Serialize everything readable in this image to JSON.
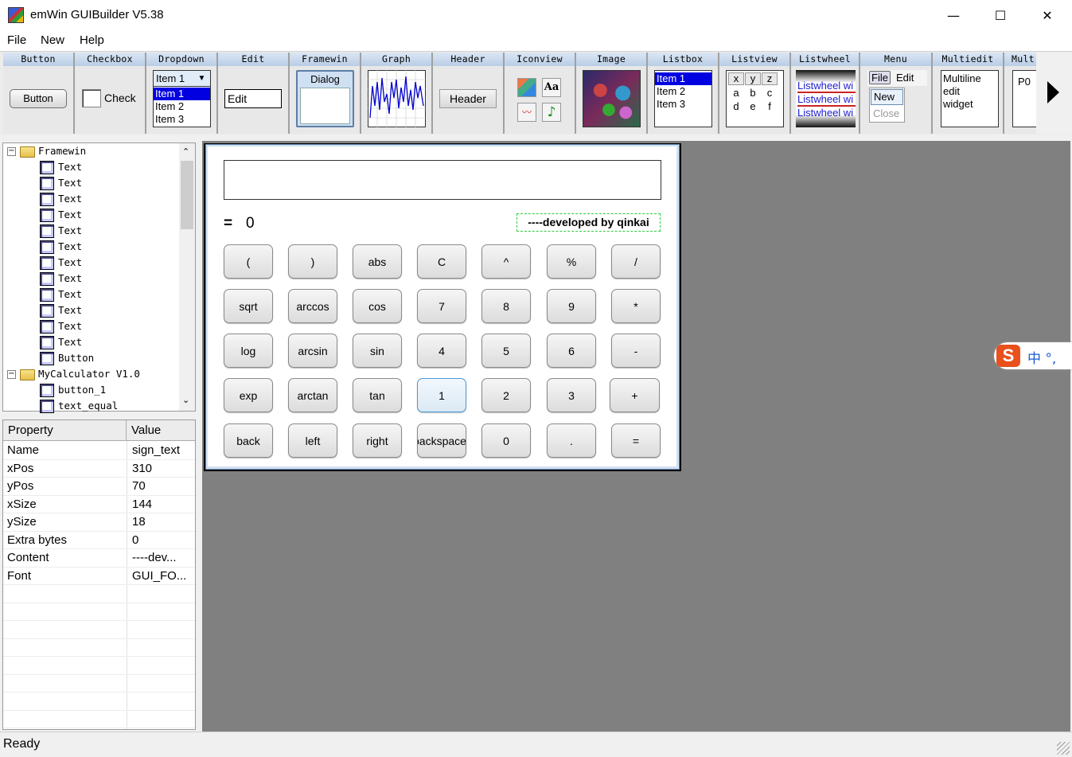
{
  "app": {
    "title": "emWin GUIBuilder V5.38",
    "min": "—",
    "max": "☐",
    "close": "✕"
  },
  "menu": [
    "File",
    "New",
    "Help"
  ],
  "palette": [
    {
      "label": "Button",
      "sample": "Button"
    },
    {
      "label": "Checkbox",
      "sample": "Check"
    },
    {
      "label": "Dropdown",
      "selected": "Item 1",
      "items": [
        "Item 1",
        "Item 2",
        "Item 3"
      ]
    },
    {
      "label": "Edit",
      "sample": "Edit"
    },
    {
      "label": "Framewin",
      "sample": "Dialog"
    },
    {
      "label": "Graph"
    },
    {
      "label": "Header",
      "sample": "Header"
    },
    {
      "label": "Iconview",
      "icons": [
        "Aa",
        "♪"
      ]
    },
    {
      "label": "Image"
    },
    {
      "label": "Listbox",
      "items": [
        "Item 1",
        "Item 2",
        "Item 3"
      ]
    },
    {
      "label": "Listview",
      "cells": [
        [
          "x",
          "y",
          "z"
        ],
        [
          "a",
          "b",
          "c"
        ],
        [
          "d",
          "e",
          "f"
        ]
      ]
    },
    {
      "label": "Listwheel",
      "items": [
        "Listwheel wi",
        "Listwheel wi",
        "Listwheel wi"
      ]
    },
    {
      "label": "Menu",
      "items": [
        "File",
        "Edit",
        "New",
        "Close"
      ]
    },
    {
      "label": "Multiedit",
      "lines": [
        "Multiline",
        "edit",
        "widget"
      ]
    },
    {
      "label": "Mult",
      "sample": "P0"
    }
  ],
  "tree": {
    "nodes": [
      {
        "label": "Framewin",
        "level": 0,
        "expander": "−",
        "folder": true
      },
      {
        "label": "Text",
        "level": 1
      },
      {
        "label": "Text",
        "level": 1
      },
      {
        "label": "Text",
        "level": 1
      },
      {
        "label": "Text",
        "level": 1
      },
      {
        "label": "Text",
        "level": 1
      },
      {
        "label": "Text",
        "level": 1
      },
      {
        "label": "Text",
        "level": 1
      },
      {
        "label": "Text",
        "level": 1
      },
      {
        "label": "Text",
        "level": 1
      },
      {
        "label": "Text",
        "level": 1
      },
      {
        "label": "Text",
        "level": 1
      },
      {
        "label": "Text",
        "level": 1
      },
      {
        "label": "Button",
        "level": 1
      },
      {
        "label": "MyCalculator V1.0",
        "level": 0,
        "expander": "−",
        "folder": true
      },
      {
        "label": "button_1",
        "level": 1
      },
      {
        "label": "text_equal",
        "level": 1
      }
    ]
  },
  "properties": {
    "headers": [
      "Property",
      "Value"
    ],
    "rows": [
      [
        "Name",
        "sign_text"
      ],
      [
        "xPos",
        "310"
      ],
      [
        "yPos",
        "70"
      ],
      [
        "xSize",
        "144"
      ],
      [
        "ySize",
        "18"
      ],
      [
        "Extra bytes",
        "0"
      ],
      [
        "Content",
        "----dev..."
      ],
      [
        "Font",
        "GUI_FO..."
      ]
    ]
  },
  "calculator": {
    "display": "",
    "equal": "=",
    "result": "0",
    "credit": "----developed by qinkai",
    "buttons": [
      [
        "(",
        ")",
        "abs",
        "C",
        "^",
        "%",
        "/"
      ],
      [
        "sqrt",
        "arccos",
        "cos",
        "7",
        "8",
        "9",
        "*"
      ],
      [
        "log",
        "arcsin",
        "sin",
        "4",
        "5",
        "6",
        "-"
      ],
      [
        "exp",
        "arctan",
        "tan",
        "1",
        "2",
        "3",
        "+"
      ],
      [
        "back",
        "left",
        "right",
        "backspace",
        "0",
        ".",
        "="
      ]
    ]
  },
  "status": "Ready",
  "ime": {
    "logo": "S",
    "text": "中 °,"
  }
}
